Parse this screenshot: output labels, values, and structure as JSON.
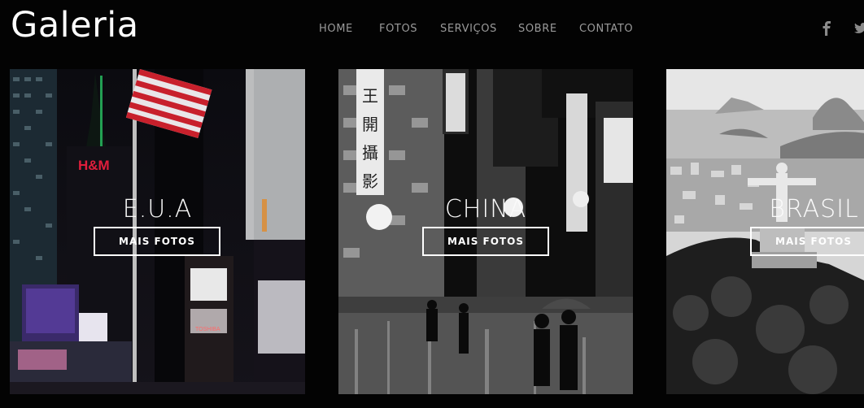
{
  "brand": {
    "logo": "Galeria"
  },
  "nav": {
    "items": [
      "HOME",
      "FOTOS",
      "SERVIÇOS",
      "SOBRE",
      "CONTATO"
    ]
  },
  "social": {
    "icons": [
      "facebook-icon",
      "twitter-icon"
    ]
  },
  "colors": {
    "background": "#030303",
    "nav_text": "#9a9a9a",
    "text": "#ffffff"
  },
  "gallery": {
    "cards": [
      {
        "title": "E.U.A",
        "button": "MAIS FOTOS"
      },
      {
        "title": "CHINA",
        "button": "MAIS FOTOS"
      },
      {
        "title": "BRASIL",
        "button": "MAIS FOTOS"
      }
    ]
  }
}
